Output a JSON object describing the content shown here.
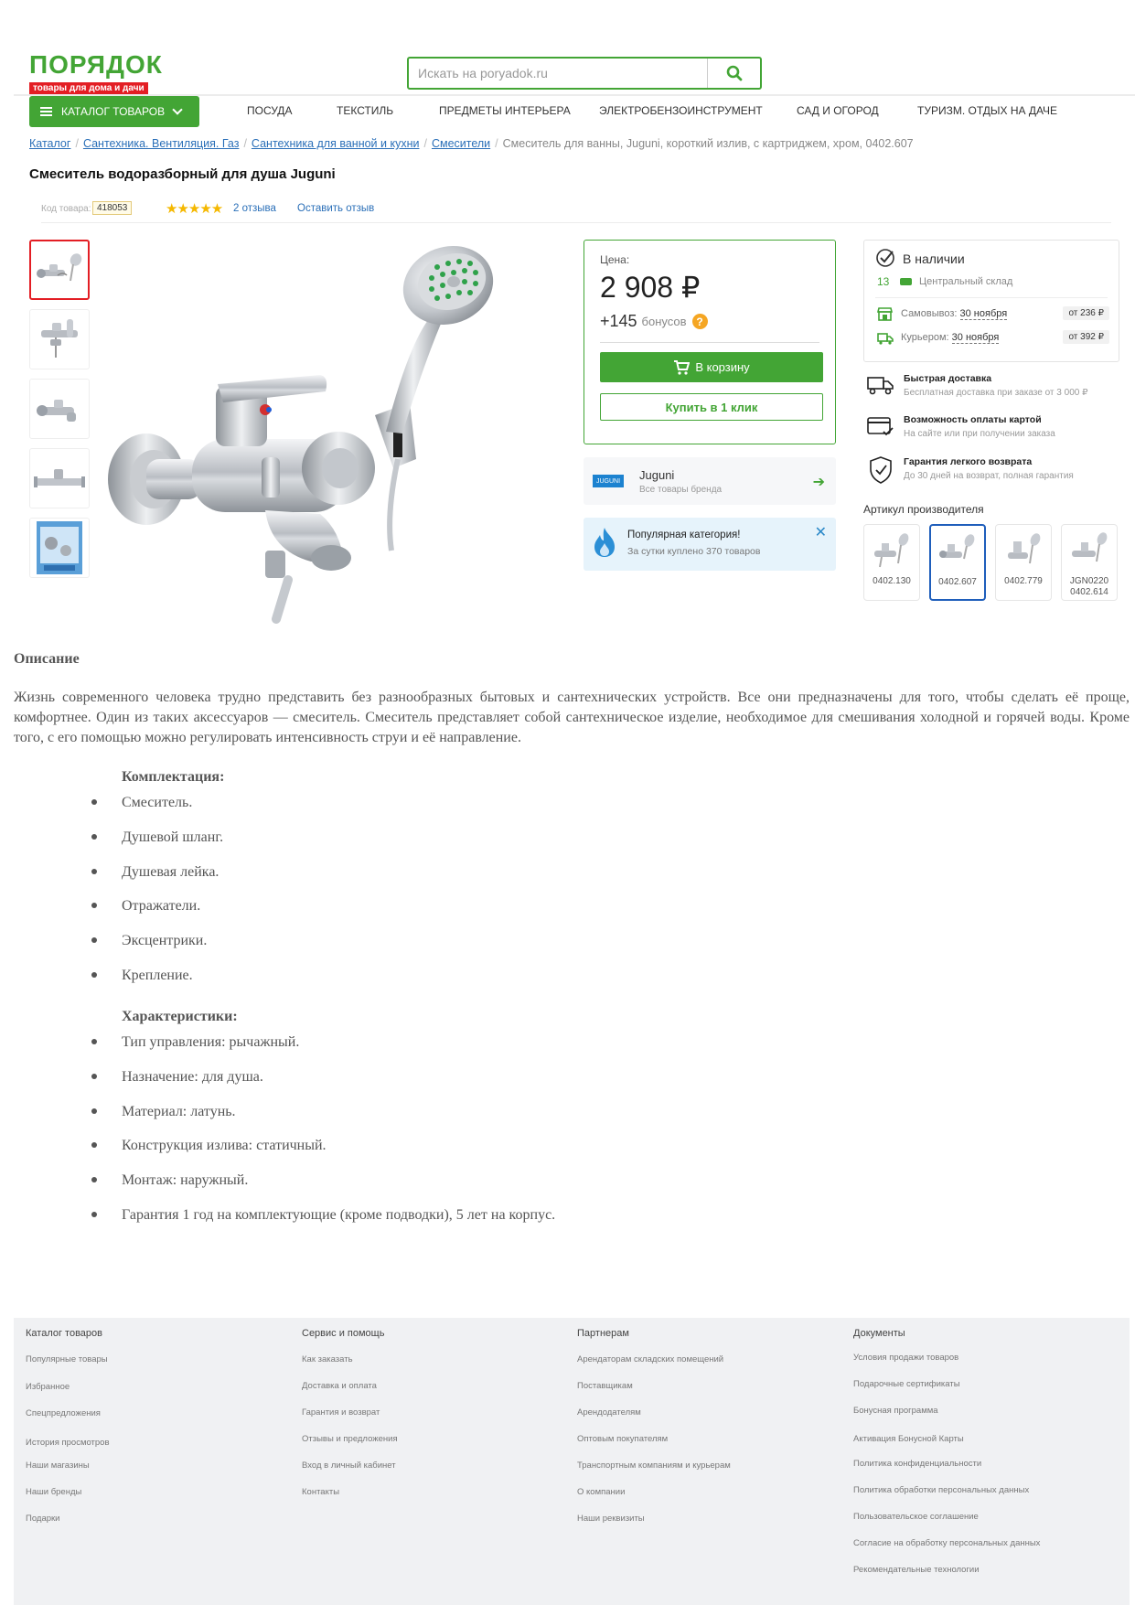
{
  "header": {
    "logo_text": "ПОРЯДОК",
    "logo_sub": "товары для дома и дачи",
    "search_placeholder": "Искать на poryadok.ru"
  },
  "nav": {
    "catalog_label": "КАТАЛОГ ТОВАРОВ",
    "items": [
      "ПОСУДА",
      "ТЕКСТИЛЬ",
      "ПРЕДМЕТЫ ИНТЕРЬЕРА",
      "ЭЛЕКТРОБЕНЗОИНСТРУМЕНТ",
      "САД И ОГОРОД",
      "ТУРИЗМ. ОТДЫХ НА ДАЧЕ"
    ]
  },
  "breadcrumb": {
    "links": [
      "Каталог",
      "Сантехника. Вентиляция. Газ",
      "Сантехника для ванной и кухни",
      "Смесители"
    ],
    "current": "Смеситель для ванны, Juguni, короткий излив, с картриджем, хром, 0402.607"
  },
  "product": {
    "title": "Смеситель водоразборный для душа Juguni",
    "code_label": "Код товара:",
    "code": "418053",
    "stars": "★★★★★",
    "rating": 5,
    "reviews": "2 отзыва",
    "leave_review": "Оставить отзыв"
  },
  "price_card": {
    "label": "Цена:",
    "price": "2 908 ₽",
    "bonus_value": "+145",
    "bonus_text": "бонусов",
    "help": "?",
    "cart_btn": "В корзину",
    "oneclick_btn": "Купить в 1 клик"
  },
  "brand": {
    "logo": "JUGUNI",
    "name": "Juguni",
    "sub": "Все товары бренда"
  },
  "popular": {
    "title": "Популярная категория!",
    "sub": "За сутки куплено 370 товаров"
  },
  "availability": {
    "title": "В наличии",
    "count": "13",
    "warehouse": "Центральный склад",
    "pickup_label": "Самовывоз:",
    "pickup_date": "30 ноября",
    "pickup_price": "от 236 ₽",
    "courier_label": "Курьером:",
    "courier_date": "30 ноября",
    "courier_price": "от 392 ₽"
  },
  "features": [
    {
      "title": "Быстрая доставка",
      "sub": "Бесплатная доставка при заказе от 3 000 ₽"
    },
    {
      "title": "Возможность оплаты картой",
      "sub": "На сайте или при получении заказа"
    },
    {
      "title": "Гарантия легкого возврата",
      "sub": "До 30 дней на возврат, полная гарантия"
    }
  ],
  "articles": {
    "title": "Артикул производителя",
    "items": [
      {
        "l1": "0402.130",
        "l2": ""
      },
      {
        "l1": "0402.607",
        "l2": ""
      },
      {
        "l1": "0402.779",
        "l2": ""
      },
      {
        "l1": "JGN0220",
        "l2": "0402.614"
      }
    ]
  },
  "description": {
    "heading": "Описание",
    "text": "Жизнь современного человека трудно представить без разнообразных бытовых и сантехнических устройств. Все они предназначены для того, чтобы сделать её проще, комфортнее. Один из таких аксессуаров — смеситель. Смеситель представляет собой сантехническое изделие, необходимое для смешивания холодной и горячей воды. Кроме того, с его помощью можно регулировать интенсивность струи и её направление.",
    "kit_heading": "Комплектация:",
    "kit": [
      "Смеситель.",
      "Душевой шланг.",
      "Душевая лейка.",
      "Отражатели.",
      "Эксцентрики.",
      "Крепление."
    ],
    "spec_heading": "Характеристики:",
    "specs": [
      "Тип управления: рычажный.",
      "Назначение: для душа.",
      "Материал: латунь.",
      "Конструкция излива: статичный.",
      "Монтаж: наружный.",
      "Гарантия 1 год на комплектующие (кроме подводки), 5 лет на корпус."
    ]
  },
  "footer": {
    "columns": [
      {
        "head": "Каталог товаров",
        "links": [
          "Популярные товары",
          "Избранное",
          "Спецпредложения",
          "История просмотров",
          "Наши магазины",
          "Наши бренды",
          "Подарки"
        ]
      },
      {
        "head": "Сервис и помощь",
        "links": [
          "Как заказать",
          "Доставка и оплата",
          "Гарантия и возврат",
          "Отзывы и предложения",
          "Вход в личный кабинет",
          "Контакты"
        ]
      },
      {
        "head": "Партнерам",
        "links": [
          "Арендаторам складских помещений",
          "Поставщикам",
          "Арендодателям",
          "Оптовым покупателям",
          "Транспортным компаниям и курьерам",
          "О компании",
          "Наши реквизиты"
        ]
      },
      {
        "head": "Документы",
        "links": [
          "Условия продажи товаров",
          "Подарочные сертификаты",
          "Бонусная программа",
          "Активация Бонусной Карты",
          "Политика конфиденциальности",
          "Политика обработки персональных данных",
          "Пользовательское соглашение",
          "Согласие на обработку персональных данных",
          "Рекомендательные технологии"
        ]
      }
    ]
  },
  "colors": {
    "brand_green": "#43a535",
    "brand_red": "#e31e24",
    "link_blue": "#2a6fb8",
    "star": "#f5b800"
  }
}
